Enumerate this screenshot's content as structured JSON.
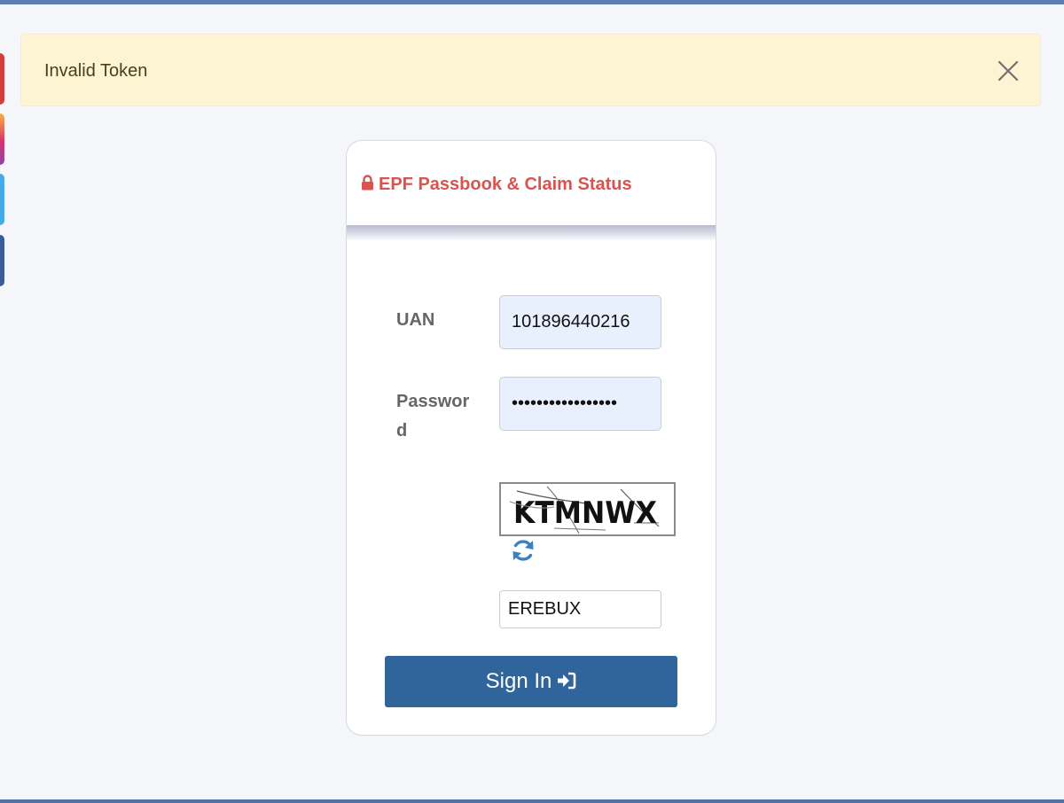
{
  "colors": {
    "page_bg": "#f4f6fa",
    "top_bar": "#5b7fb3",
    "bottom_bar": "#4f73a8",
    "alert_bg": "#fdf4d3",
    "title": "#d9534f",
    "button": "#2f659a",
    "refresh": "#3a80c1"
  },
  "social_tabs": [
    {
      "name": "social-tab-red",
      "color": "#d23f3a"
    },
    {
      "name": "social-tab-instagram",
      "color": "#c13584"
    },
    {
      "name": "social-tab-twitter",
      "color": "#46a9e8"
    },
    {
      "name": "social-tab-facebook",
      "color": "#3d5a99"
    }
  ],
  "alert": {
    "message": "Invalid Token",
    "close_icon": "close-icon"
  },
  "card": {
    "title": "EPF Passbook & Claim Status",
    "title_icon": "lock-icon",
    "uan_label": "UAN",
    "uan_value": "101896440216",
    "password_label": "Password",
    "password_value": "•••••••••••••••••",
    "captcha_text": "KTMNWX",
    "refresh_icon": "refresh-icon",
    "captcha_input_value": "EREBUX",
    "signin_label": "Sign In",
    "signin_icon": "sign-in-icon"
  }
}
